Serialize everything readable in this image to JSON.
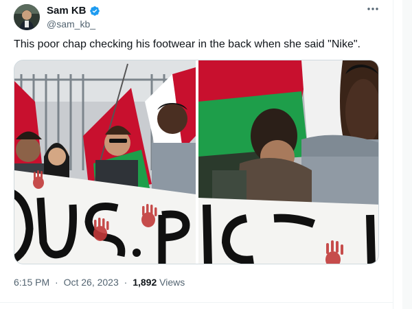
{
  "author": {
    "display_name": "Sam KB",
    "handle": "@sam_kb_",
    "verified": true
  },
  "tweet": {
    "text": "This poor chap checking his footwear in the back when she said \"Nike\"."
  },
  "meta": {
    "time": "6:15 PM",
    "separator": "·",
    "date": "Oct 26, 2023",
    "views_count": "1,892",
    "views_label": "Views"
  },
  "icons": {
    "more": "more-horizontal-icon",
    "verified": "verified-badge-icon"
  },
  "colors": {
    "text_primary": "#0f1419",
    "text_secondary": "#536471",
    "verified_blue": "#1d9bf0",
    "flag_red": "#c8102e",
    "flag_green": "#1e9e4a",
    "banner_black": "#101010",
    "hand_red": "#c23a3a"
  }
}
